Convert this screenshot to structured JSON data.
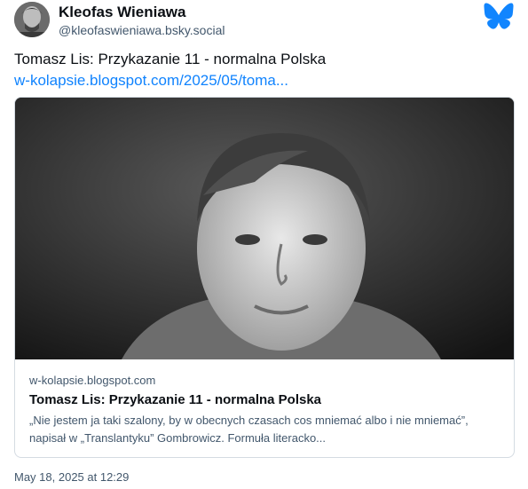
{
  "author": {
    "display_name": "Kleofas Wieniawa",
    "handle": "@kleofaswieniawa.bsky.social",
    "avatar_icon": "avatar-photo"
  },
  "brand": {
    "icon": "bluesky-butterfly-icon",
    "color": "#1185fe"
  },
  "post": {
    "text": "Tomasz Lis: Przykazanie 11 - normalna Polska",
    "link_text": "w-kolapsie.blogspot.com/2025/05/toma...",
    "link_color": "#1083fe"
  },
  "card": {
    "image": "black-and-white-portrait-photo",
    "domain": "w-kolapsie.blogspot.com",
    "title": "Tomasz Lis: Przykazanie 11 - normalna Polska",
    "description": "„Nie jestem ja taki szalony, by w obecnych czasach cos mniemać albo i nie mniemać”, napisał w „Translantyku” Gombrowicz. Formuła literacko..."
  },
  "timestamp": "May 18, 2025 at 12:29"
}
